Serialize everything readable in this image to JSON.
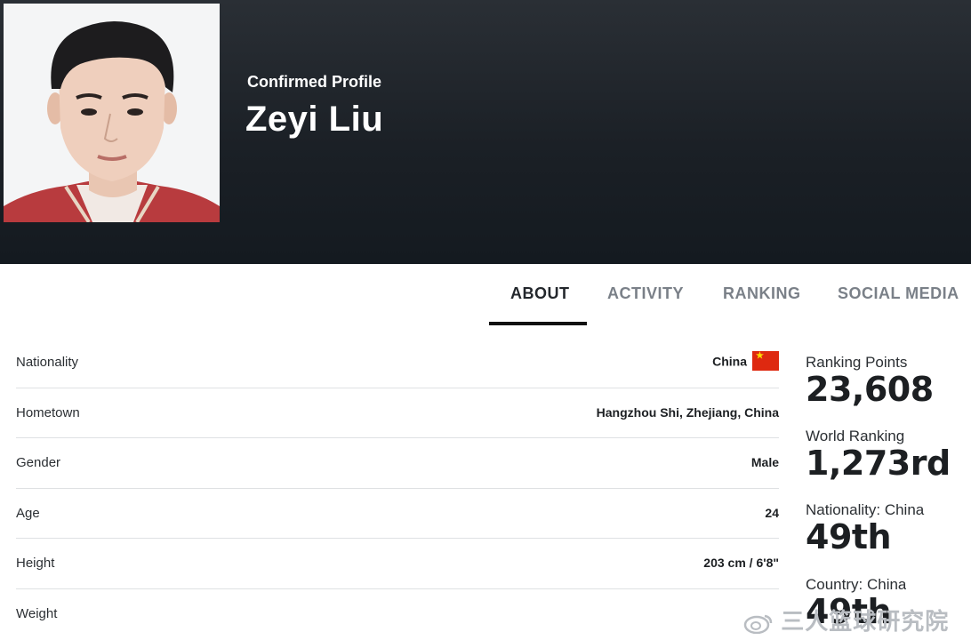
{
  "header": {
    "subtitle": "Confirmed Profile",
    "name": "Zeyi Liu"
  },
  "tabs": [
    {
      "label": "ABOUT",
      "active": true
    },
    {
      "label": "ACTIVITY",
      "active": false
    },
    {
      "label": "RANKING",
      "active": false
    },
    {
      "label": "SOCIAL MEDIA",
      "active": false
    }
  ],
  "about": [
    {
      "label": "Nationality",
      "value": "China",
      "flag_icon": "china-flag-icon"
    },
    {
      "label": "Hometown",
      "value": "Hangzhou Shi, Zhejiang, China"
    },
    {
      "label": "Gender",
      "value": "Male"
    },
    {
      "label": "Age",
      "value": "24"
    },
    {
      "label": "Height",
      "value": "203 cm / 6'8\""
    },
    {
      "label": "Weight",
      "value": ""
    }
  ],
  "stats": [
    {
      "label": "Ranking Points",
      "value": "23,608"
    },
    {
      "label": "World Ranking",
      "value": "1,273rd"
    },
    {
      "label": "Nationality: China",
      "value": "49th"
    },
    {
      "label": "Country: China",
      "value": "49th"
    }
  ],
  "watermark": "三人篮球研究院",
  "colors": {
    "header_bg": "#1b2026",
    "active_tab": "#23272c",
    "inactive_tab": "#7a8088",
    "flag_red": "#de2910"
  }
}
